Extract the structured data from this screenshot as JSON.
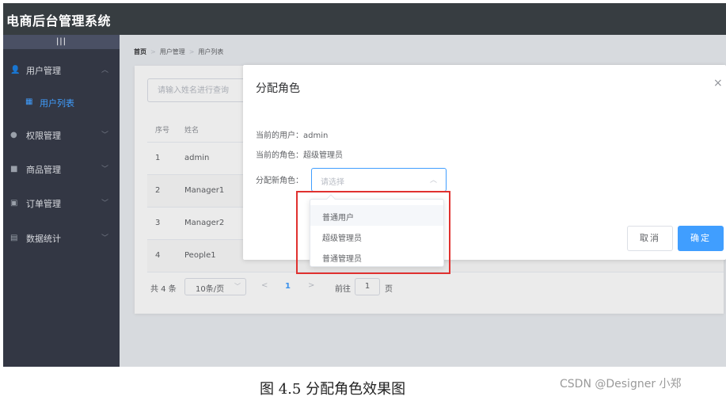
{
  "app": {
    "title": "电商后台管理系统"
  },
  "sidebar": {
    "toggle_label": "|||",
    "items": [
      {
        "label": "用户管理",
        "icon": "user-icon",
        "glyph": "👤",
        "chevron": "︿"
      },
      {
        "label": "用户列表",
        "icon": "grid-icon",
        "glyph": "▦"
      },
      {
        "label": "权限管理",
        "icon": "lock-icon",
        "glyph": "●",
        "chevron": "﹀"
      },
      {
        "label": "商品管理",
        "icon": "shop-icon",
        "glyph": "■",
        "chevron": "﹀"
      },
      {
        "label": "订单管理",
        "icon": "order-icon",
        "glyph": "▣",
        "chevron": "﹀"
      },
      {
        "label": "数据统计",
        "icon": "chart-icon",
        "glyph": "▤",
        "chevron": "﹀"
      }
    ]
  },
  "breadcrumb": {
    "home": "首页",
    "sep": ">",
    "level1": "用户管理",
    "level2": "用户列表"
  },
  "search": {
    "placeholder": "请输入姓名进行查询"
  },
  "table": {
    "headers": [
      "序号",
      "姓名"
    ],
    "rows": [
      {
        "index": "1",
        "name": "admin"
      },
      {
        "index": "2",
        "name": "Manager1"
      },
      {
        "index": "3",
        "name": "Manager2"
      },
      {
        "index": "4",
        "name": "People1"
      }
    ]
  },
  "pagination": {
    "total": "共 4 条",
    "page_size": "10条/页",
    "size_arrow": "﹀",
    "prev": "<",
    "current": "1",
    "next": ">",
    "goto_label": "前往",
    "goto_value": "1",
    "page_suffix": "页"
  },
  "dialog": {
    "title": "分配角色",
    "close": "×",
    "current_user": "当前的用户：admin",
    "current_role": "当前的角色：超级管理员",
    "assign_label": "分配新角色：",
    "select_placeholder": "请选择",
    "select_arrow": "︿",
    "cancel_label": "取消",
    "confirm_label": "确定"
  },
  "dropdown": {
    "options": [
      "普通用户",
      "超级管理员",
      "普通管理员"
    ]
  },
  "colors": {
    "primary": "#409eff",
    "header": "#373d41",
    "sidebar": "#333744",
    "highlight_box": "#e0312f"
  },
  "caption": "图 4.5  分配角色效果图",
  "watermark": "CSDN @Designer 小郑"
}
